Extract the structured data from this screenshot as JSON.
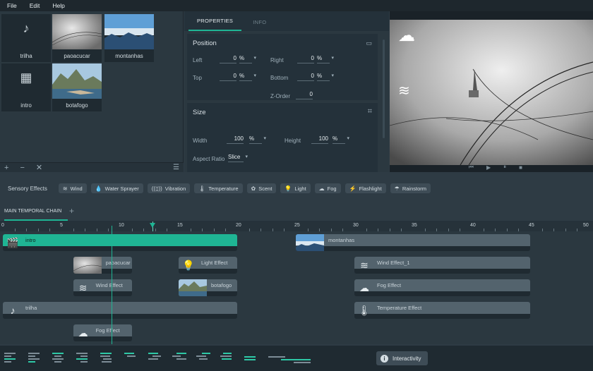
{
  "menu": [
    "File",
    "Edit",
    "Help"
  ],
  "media": [
    {
      "label": "trilha",
      "icon": "music-note-icon",
      "glyph": "♪"
    },
    {
      "label": "paoacucar",
      "thumb": "fog"
    },
    {
      "label": "montanhas",
      "thumb": "sky"
    },
    {
      "label": "intro",
      "icon": "clapperboard-icon",
      "glyph": "🎬"
    },
    {
      "label": "botafogo",
      "thumb": "city"
    }
  ],
  "bin_tools": {
    "add": "+",
    "remove": "−",
    "close": "✕",
    "list": "☰"
  },
  "tabs": [
    "PROPERTIES",
    "INFO"
  ],
  "position": {
    "title": "Position",
    "left_label": "Left",
    "left": "0",
    "left_unit": "%",
    "right_label": "Right",
    "right": "0",
    "right_unit": "%",
    "top_label": "Top",
    "top": "0",
    "top_unit": "%",
    "bottom_label": "Bottom",
    "bottom": "0",
    "bottom_unit": "%",
    "zorder_label": "Z-Order",
    "zorder": "0"
  },
  "size": {
    "title": "Size",
    "width_label": "Width",
    "width": "100",
    "width_unit": "%",
    "height_label": "Height",
    "height": "100",
    "height_unit": "%",
    "aspect_label": "Aspect Ratio",
    "aspect": "Slice"
  },
  "sensory": {
    "title": "Sensory Effects",
    "effects": [
      {
        "label": "Wind",
        "icon": "wind-icon",
        "glyph": "≋"
      },
      {
        "label": "Water Sprayer",
        "icon": "water-drop-icon",
        "glyph": "💧"
      },
      {
        "label": "Vibration",
        "icon": "vibration-icon",
        "glyph": "((▯))"
      },
      {
        "label": "Temperature",
        "icon": "thermometer-icon",
        "glyph": "🌡"
      },
      {
        "label": "Scent",
        "icon": "scent-icon",
        "glyph": "✿"
      },
      {
        "label": "Light",
        "icon": "light-bulb-icon",
        "glyph": "💡"
      },
      {
        "label": "Fog",
        "icon": "fog-cloud-icon",
        "glyph": "☁"
      },
      {
        "label": "Flashlight",
        "icon": "flashlight-icon",
        "glyph": "⚡"
      },
      {
        "label": "Rainstorm",
        "icon": "rainstorm-icon",
        "glyph": "☂"
      }
    ]
  },
  "timeline": {
    "chain_title": "MAIN TEMPORAL CHAIN",
    "ticks": [
      "0",
      "5",
      "10",
      "15",
      "20",
      "25",
      "30",
      "35",
      "40",
      "45",
      "50"
    ],
    "clips": [
      {
        "name": "intro",
        "start": 0,
        "end": 20,
        "row": 0,
        "kind": "icon",
        "glyph": "🎬",
        "icon": "clapperboard-icon",
        "selected": true
      },
      {
        "name": "montanhas",
        "start": 25,
        "end": 45,
        "row": 0,
        "kind": "thumb",
        "thumb": "sky"
      },
      {
        "name": "paoacucar",
        "start": 6,
        "end": 11,
        "row": 1,
        "kind": "thumb",
        "thumb": "fog"
      },
      {
        "name": "Light Effect",
        "start": 15,
        "end": 20,
        "row": 1,
        "kind": "icon",
        "glyph": "💡",
        "icon": "light-bulb-icon"
      },
      {
        "name": "Wind Effect_1",
        "start": 30,
        "end": 45,
        "row": 1,
        "kind": "icon",
        "glyph": "≋",
        "icon": "wind-icon"
      },
      {
        "name": "Wind Effect",
        "start": 6,
        "end": 11,
        "row": 2,
        "kind": "icon",
        "glyph": "≋",
        "icon": "wind-icon"
      },
      {
        "name": "botafogo",
        "start": 15,
        "end": 20,
        "row": 2,
        "kind": "thumb",
        "thumb": "city"
      },
      {
        "name": "Fog Effect",
        "start": 30,
        "end": 45,
        "row": 2,
        "kind": "icon",
        "glyph": "☁",
        "icon": "fog-cloud-icon"
      },
      {
        "name": "trilha",
        "start": 0,
        "end": 20,
        "row": 3,
        "kind": "icon",
        "glyph": "♪",
        "icon": "music-note-icon"
      },
      {
        "name": "Temperature Effect",
        "start": 30,
        "end": 45,
        "row": 3,
        "kind": "icon",
        "glyph": "🌡",
        "icon": "thermometer-icon"
      },
      {
        "name": "Fog Effect",
        "start": 6,
        "end": 11,
        "row": 4,
        "kind": "icon",
        "glyph": "☁",
        "icon": "fog-cloud-icon"
      }
    ],
    "playhead": 9.3,
    "marker": 12.8
  },
  "interactivity_label": "Interactivity",
  "colors": {
    "accent": "#1fb594",
    "panel": "#2b3840",
    "dark": "#1f2a31"
  }
}
